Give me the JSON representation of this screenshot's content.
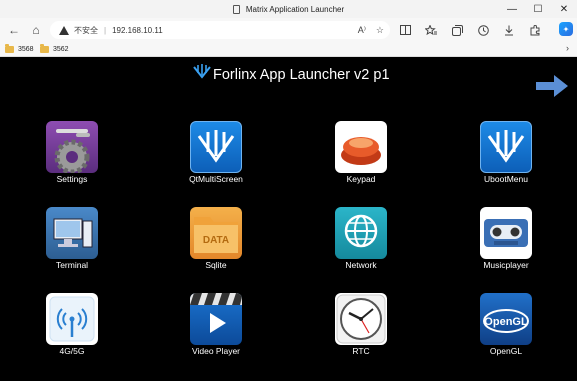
{
  "browser": {
    "window_title": "Matrix Application Launcher",
    "minimize_glyph": "—",
    "maximize_glyph": "☐",
    "close_glyph": "✕",
    "back_glyph": "←",
    "home_glyph": "⌂",
    "security_label": "不安全",
    "url": "192.168.10.11",
    "read_aloud_glyph": "A⁾",
    "favorite_glyph": "☆",
    "copilot_glyph": "✦",
    "more_favorites_glyph": "›",
    "favorites": [
      {
        "label": "3568"
      },
      {
        "label": "3562"
      }
    ]
  },
  "app": {
    "title": "Forlinx App Launcher v2 p1",
    "apps": [
      {
        "label": "Settings",
        "icon": "settings-icon"
      },
      {
        "label": "QtMultiScreen",
        "icon": "qtmultiscreen-icon"
      },
      {
        "label": "Keypad",
        "icon": "keypad-icon"
      },
      {
        "label": "UbootMenu",
        "icon": "ubootmenu-icon"
      },
      {
        "label": "Terminal",
        "icon": "terminal-icon"
      },
      {
        "label": "Sqlite",
        "icon": "sqlite-icon",
        "badge": "DATA"
      },
      {
        "label": "Network",
        "icon": "network-icon"
      },
      {
        "label": "Musicplayer",
        "icon": "musicplayer-icon"
      },
      {
        "label": "4G/5G",
        "icon": "cellular-icon"
      },
      {
        "label": "Video Player",
        "icon": "video-player-icon"
      },
      {
        "label": "RTC",
        "icon": "clock-icon"
      },
      {
        "label": "OpenGL",
        "icon": "opengl-icon",
        "badge": "OpenGL"
      }
    ]
  },
  "colors": {
    "background": "#000000",
    "accent_blue": "#1d8ae6",
    "arrow_blue": "#5b8fd6"
  }
}
